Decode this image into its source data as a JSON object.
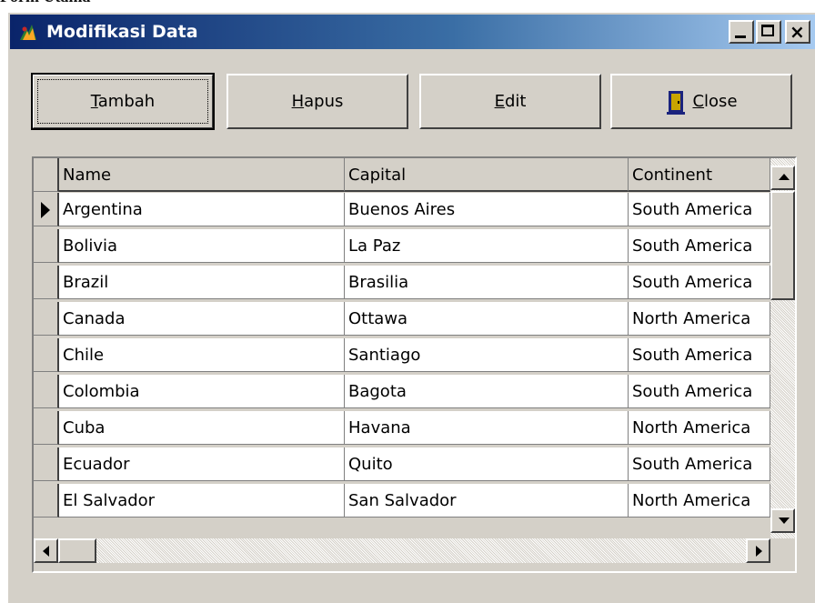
{
  "fragment_text": "Form Utama",
  "window": {
    "title": "Modifikasi Data",
    "title_icon": "app-icon",
    "caption_buttons": [
      "minimize-icon",
      "maximize-icon",
      "close-x-icon"
    ],
    "close_glyph": "×"
  },
  "toolbar": {
    "tambah": {
      "accel": "T",
      "rest": "ambah"
    },
    "hapus": {
      "accel": "H",
      "rest": "apus"
    },
    "edit": {
      "accel": "E",
      "rest": "dit"
    },
    "close": {
      "accel": "C",
      "rest": "lose",
      "icon": "door-exit-icon"
    }
  },
  "grid": {
    "columns": [
      "Name",
      "Capital",
      "Continent"
    ],
    "rows": [
      {
        "name": "Argentina",
        "capital": "Buenos Aires",
        "continent": "South America"
      },
      {
        "name": "Bolivia",
        "capital": "La Paz",
        "continent": "South America"
      },
      {
        "name": "Brazil",
        "capital": "Brasilia",
        "continent": "South America"
      },
      {
        "name": "Canada",
        "capital": "Ottawa",
        "continent": "North America"
      },
      {
        "name": "Chile",
        "capital": "Santiago",
        "continent": "South America"
      },
      {
        "name": "Colombia",
        "capital": "Bagota",
        "continent": "South America"
      },
      {
        "name": "Cuba",
        "capital": "Havana",
        "continent": "North America"
      },
      {
        "name": "Ecuador",
        "capital": "Quito",
        "continent": "South America"
      },
      {
        "name": "El Salvador",
        "capital": "San Salvador",
        "continent": "North America"
      }
    ],
    "current_row": 0
  },
  "colors": {
    "titlebar_start": "#0a246a",
    "titlebar_end": "#a6caf0",
    "face": "#d4d0c8"
  }
}
